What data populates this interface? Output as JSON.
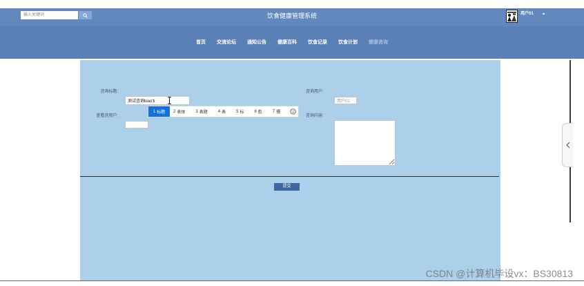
{
  "header": {
    "search": {
      "placeholder": "输入关键词",
      "value": ""
    },
    "search_button_icon": "search-icon",
    "title": "饮食健康管理系统",
    "user": {
      "avatar_icon": "avatar-icon",
      "name": "用户01",
      "dropdown_icon": "caret-down-icon"
    }
  },
  "nav": {
    "items": [
      {
        "label": "首页"
      },
      {
        "label": "交流论坛"
      },
      {
        "label": "通知公告"
      },
      {
        "label": "健康百科"
      },
      {
        "label": "饮食记录"
      },
      {
        "label": "饮食计划"
      },
      {
        "label": "健康咨询"
      }
    ],
    "active_index": 6
  },
  "form": {
    "title": {
      "label": "咨询标题:",
      "value": "测试咨询biao'ti"
    },
    "viewer": {
      "label": "查看咨用户:",
      "value": ""
    },
    "consult_user": {
      "label": "咨询用户:",
      "value": "用户01"
    },
    "content": {
      "label": "咨询内容:",
      "value": ""
    },
    "submit_label": "提交"
  },
  "ime": {
    "candidates": [
      {
        "index": "1",
        "text": "标题"
      },
      {
        "index": "2",
        "text": "表体"
      },
      {
        "index": "3",
        "text": "表题"
      },
      {
        "index": "4",
        "text": "表"
      },
      {
        "index": "5",
        "text": "标"
      },
      {
        "index": "6",
        "text": "彪"
      },
      {
        "index": "7",
        "text": "镖"
      }
    ],
    "selected_index": 0,
    "emoji_icon": "smiley-icon"
  },
  "mouse_cursor_icon": "text-cursor-icon",
  "side_tab_icon": "chevron-left-icon",
  "watermark": "CSDN @计算机毕设vx：BS30813",
  "colors": {
    "header_bg": "#6288be",
    "nav_bg": "#5b80b7",
    "panel_bg": "#acd0ea",
    "button_bg": "#3d66a4",
    "ime_highlight": "#1670dc",
    "nav_active": "#a6bfe2",
    "search_btn": "#86a8d6"
  }
}
